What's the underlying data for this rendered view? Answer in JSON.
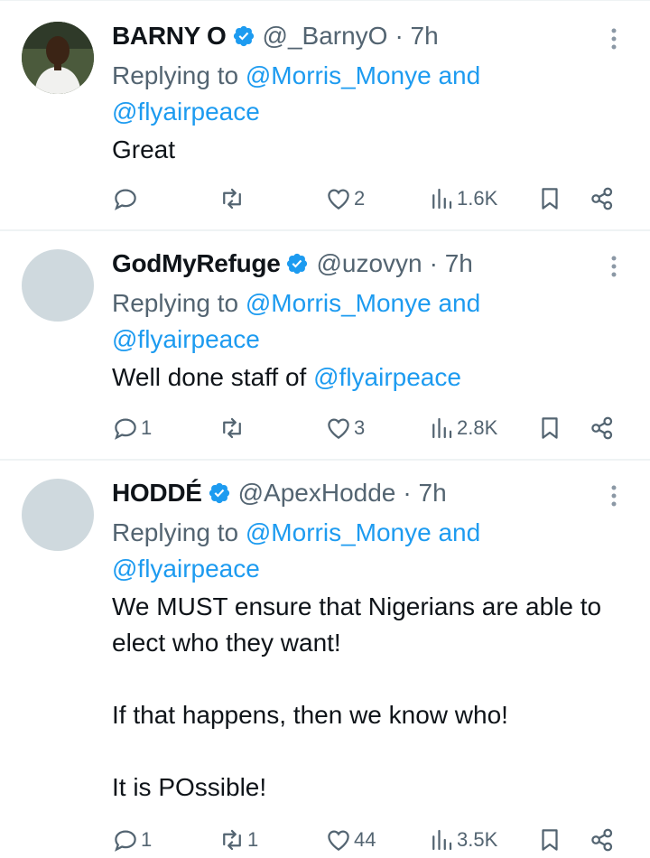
{
  "tweets": [
    {
      "name": "BARNY O",
      "handle": "@_BarnyO",
      "time": "· 7h",
      "reply_prefix": "Replying to",
      "reply_mention1": "@Morris_Monye",
      "reply_and": "and",
      "reply_mention2": "@flyairpeace",
      "text": "Great",
      "replies": "",
      "retweets": "",
      "likes": "2",
      "views": "1.6K",
      "avatar": "photo"
    },
    {
      "name": "GodMyRefuge",
      "handle": "@uzovyn",
      "time": "· 7h",
      "reply_prefix": "Replying to",
      "reply_mention1": "@Morris_Monye",
      "reply_and": "and",
      "reply_mention2": "@flyairpeace",
      "text_prefix": "Well done staff of ",
      "text_mention": "@flyairpeace",
      "replies": "1",
      "retweets": "",
      "likes": "3",
      "views": "2.8K",
      "avatar": "placeholder"
    },
    {
      "name": "HODDÉ",
      "handle": "@ApexHodde",
      "time": "· 7h",
      "reply_prefix": "Replying to",
      "reply_mention1": "@Morris_Monye",
      "reply_and": "and",
      "reply_mention2": "@flyairpeace",
      "text": "We MUST ensure that Nigerians are able to elect who they want!\n\nIf that happens, then we know who!\n\nIt is POssible!",
      "replies": "1",
      "retweets": "1",
      "likes": "44",
      "views": "3.5K",
      "avatar": "placeholder"
    }
  ],
  "colors": {
    "link": "#1d9bf0",
    "muted": "#536471",
    "text": "#0f1419",
    "divider": "#eff3f4"
  },
  "icons": [
    "verified-badge-icon",
    "more-icon",
    "reply-icon",
    "retweet-icon",
    "like-icon",
    "views-icon",
    "bookmark-icon",
    "share-icon"
  ]
}
